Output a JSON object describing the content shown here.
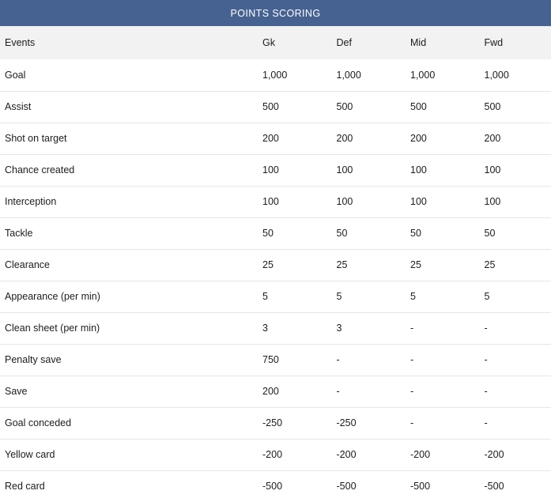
{
  "title": "POINTS SCORING",
  "table": {
    "columns": [
      "Events",
      "Gk",
      "Def",
      "Mid",
      "Fwd"
    ],
    "rows": [
      {
        "event": "Goal",
        "gk": "1,000",
        "def": "1,000",
        "mid": "1,000",
        "fwd": "1,000"
      },
      {
        "event": "Assist",
        "gk": "500",
        "def": "500",
        "mid": "500",
        "fwd": "500"
      },
      {
        "event": "Shot on target",
        "gk": "200",
        "def": "200",
        "mid": "200",
        "fwd": "200"
      },
      {
        "event": "Chance created",
        "gk": "100",
        "def": "100",
        "mid": "100",
        "fwd": "100"
      },
      {
        "event": "Interception",
        "gk": "100",
        "def": "100",
        "mid": "100",
        "fwd": "100"
      },
      {
        "event": "Tackle",
        "gk": "50",
        "def": "50",
        "mid": "50",
        "fwd": "50"
      },
      {
        "event": "Clearance",
        "gk": "25",
        "def": "25",
        "mid": "25",
        "fwd": "25"
      },
      {
        "event": "Appearance (per min)",
        "gk": "5",
        "def": "5",
        "mid": "5",
        "fwd": "5"
      },
      {
        "event": "Clean sheet (per min)",
        "gk": "3",
        "def": "3",
        "mid": "-",
        "fwd": "-"
      },
      {
        "event": "Penalty save",
        "gk": "750",
        "def": "-",
        "mid": "-",
        "fwd": "-"
      },
      {
        "event": "Save",
        "gk": "200",
        "def": "-",
        "mid": "-",
        "fwd": "-"
      },
      {
        "event": "Goal conceded",
        "gk": "-250",
        "def": "-250",
        "mid": "-",
        "fwd": "-"
      },
      {
        "event": "Yellow card",
        "gk": "-200",
        "def": "-200",
        "mid": "-200",
        "fwd": "-200"
      },
      {
        "event": "Red card",
        "gk": "-500",
        "def": "-500",
        "mid": "-500",
        "fwd": "-500"
      }
    ]
  },
  "colors": {
    "header_bar": "#466291",
    "column_header_bg": "#f2f2f2",
    "row_border": "#e6e6e6",
    "text": "#1c1c1c"
  }
}
